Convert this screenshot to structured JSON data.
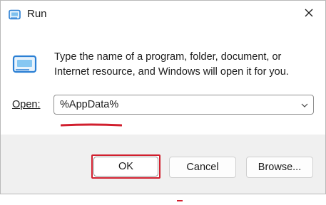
{
  "window": {
    "title": "Run",
    "icon": "run-icon",
    "close_icon": "close-icon"
  },
  "content": {
    "description": "Type the name of a program, folder, document, or Internet resource, and Windows will open it for you.",
    "icon": "run-icon"
  },
  "open": {
    "label": "Open:",
    "value": "%AppData%",
    "dropdown_icon": "chevron-down-icon"
  },
  "buttons": {
    "ok": "OK",
    "cancel": "Cancel",
    "browse": "Browse..."
  },
  "colors": {
    "highlight": "#d11f2e",
    "accent": "#1f6fd1",
    "footer": "#f0f0f0"
  }
}
